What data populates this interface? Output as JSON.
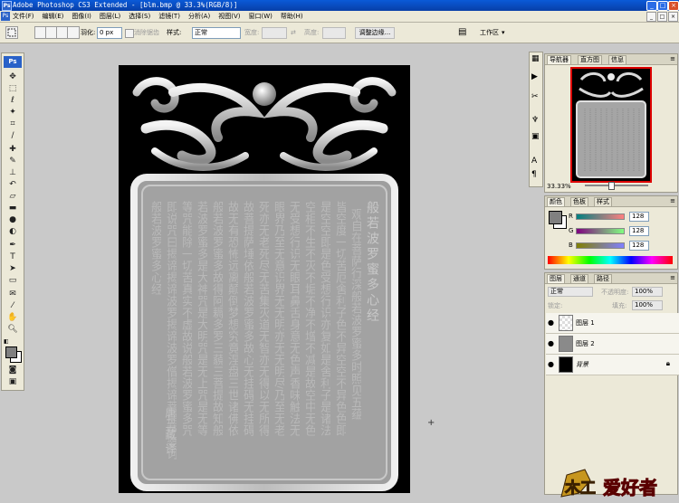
{
  "app": {
    "title": "Adobe Photoshop CS3 Extended - [blm.bmp @ 33.3%(RGB/8)]",
    "logo": "Ps",
    "min_icon": "_",
    "max_icon": "□",
    "close_icon": "×"
  },
  "menu": [
    "文件(F)",
    "编辑(E)",
    "图像(I)",
    "图层(L)",
    "选择(S)",
    "滤镜(T)",
    "分析(A)",
    "视图(V)",
    "窗口(W)",
    "帮助(H)"
  ],
  "options": {
    "feather_label": "羽化:",
    "feather_value": "0 px",
    "antialias_label": "消除锯齿",
    "style_label": "样式:",
    "style_value": "正常",
    "width_label": "宽度:",
    "height_label": "高度:",
    "refine_label": "调整边缘...",
    "workspace_label": "工作区"
  },
  "navigator": {
    "tabs": [
      "导航器",
      "直方图",
      "信息"
    ],
    "zoom": "33.33%"
  },
  "color": {
    "tabs": [
      "颜色",
      "色板",
      "样式"
    ],
    "channels": [
      {
        "label": "R",
        "value": "128"
      },
      {
        "label": "G",
        "value": "128"
      },
      {
        "label": "B",
        "value": "128"
      }
    ]
  },
  "layers": {
    "tabs": [
      "图层",
      "通道",
      "路径"
    ],
    "blend": "正常",
    "opacity_label": "不透明度:",
    "opacity_value": "100%",
    "lock_label": "锁定:",
    "fill_label": "填充:",
    "fill_value": "100%",
    "items": [
      {
        "name": "图层 1"
      },
      {
        "name": "图层 2"
      },
      {
        "name": "背景"
      }
    ]
  },
  "carving": {
    "title": "般若波罗蜜多心经",
    "author": "唐三藏 译",
    "columns": [
      "观自在菩萨行深般若波罗蜜多时照见五蕴",
      "皆空度一切苦厄舍利子色不异空空不异色色即",
      "是空空即是色受想行识亦复如是舍利子是诸法",
      "空相不生不灭不垢不净不增不减是故空中无色",
      "无受想行识无眼耳鼻舌身意无色声香味触法无",
      "眼界乃至无意识界无无明亦无无明尽乃至无老",
      "死亦无老死尽无苦集灭道无智亦无得以无所得",
      "故菩提萨埵依般若波罗蜜多故心无挂碍无挂碍",
      "故无有恐怖远离颠倒梦想究竟涅盘三世诸佛依",
      "般若波罗蜜多故得阿耨多罗三藐三菩提故知般",
      "若波罗蜜多是大神咒是大明咒是无上咒是无等",
      "等咒能除一切苦真实不虚故说般若波罗蜜多咒",
      "即说咒曰揭谛揭谛波罗揭谛波罗僧揭谛菩提萨婆诃",
      "般若波罗蜜多心经"
    ]
  },
  "watermark": {
    "text1": "木工",
    "text2": "爱好者"
  }
}
